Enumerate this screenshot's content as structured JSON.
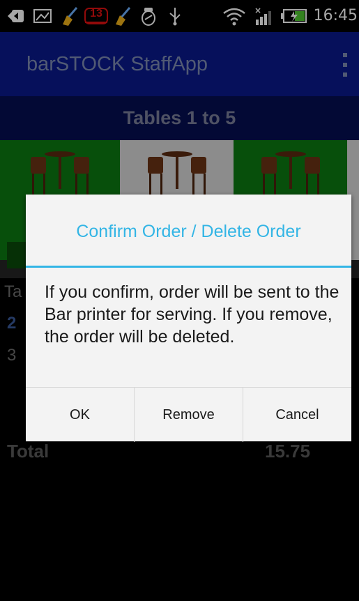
{
  "status_bar": {
    "time": "16:45",
    "notification_badge": "13",
    "icons": [
      "back-arrow-icon",
      "image-icon",
      "broom-icon",
      "badge-icon",
      "broom-icon",
      "salt-shaker-icon",
      "usb-icon",
      "wifi-icon",
      "signal-icon",
      "battery-icon"
    ]
  },
  "action_bar": {
    "title": "barSTOCK StaffApp",
    "overflow_icon": "more-vert-icon"
  },
  "tables_header": "Tables 1 to 5",
  "colors": {
    "action_bar": "#0a1a8c",
    "accent": "#33b5e5",
    "table_selected": "#0b7a12",
    "table_default": "#d8d8d8"
  },
  "background_list": {
    "rows": [
      "Ta",
      "2",
      "3"
    ],
    "total_label": "Total",
    "total_value": "15.75"
  },
  "dialog": {
    "title": "Confirm Order / Delete Order",
    "message": "If you confirm, order will be sent to the Bar printer for serving. If you remove, the order will be deleted.",
    "buttons": {
      "ok": "OK",
      "remove": "Remove",
      "cancel": "Cancel"
    }
  }
}
